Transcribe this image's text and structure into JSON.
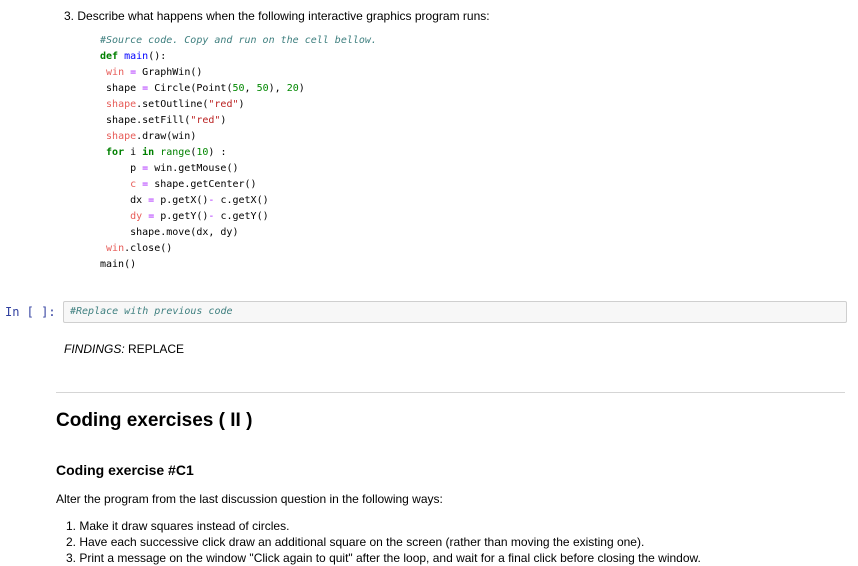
{
  "colors": {
    "comment": "#408080",
    "keyword": "#008000",
    "builtin": "#008000",
    "defname": "#0000ff",
    "operator": "#aa22ff",
    "number": "#008800",
    "string": "#ba2121",
    "error": "#e75c58",
    "plain": "#000000",
    "prompt": "#303f9f",
    "cell-bg": "#f7f7f7",
    "cell-border": "#cfcfcf",
    "divider": "#d5d5d5"
  },
  "question": {
    "marker": "3.",
    "text": "Describe what happens when the following interactive graphics program runs:"
  },
  "code_block": {
    "language": "python",
    "lines": [
      [
        [
          "c",
          "#Source code. Copy and run on the cell bellow."
        ]
      ],
      [
        [
          "k",
          "def"
        ],
        [
          "t",
          " "
        ],
        [
          "d",
          "main"
        ],
        [
          "t",
          "():"
        ]
      ],
      [
        [
          "t",
          " "
        ],
        [
          "e",
          "win"
        ],
        [
          "t",
          " "
        ],
        [
          "o",
          "="
        ],
        [
          "t",
          " GraphWin()"
        ]
      ],
      [
        [
          "t",
          " shape "
        ],
        [
          "o",
          "="
        ],
        [
          "t",
          " Circle(Point("
        ],
        [
          "n",
          "50"
        ],
        [
          "t",
          ", "
        ],
        [
          "n",
          "50"
        ],
        [
          "t",
          "), "
        ],
        [
          "n",
          "20"
        ],
        [
          "t",
          ")"
        ]
      ],
      [
        [
          "t",
          " "
        ],
        [
          "e",
          "shape"
        ],
        [
          "t",
          ".setOutline("
        ],
        [
          "s",
          "\"red\""
        ],
        [
          "t",
          ")"
        ]
      ],
      [
        [
          "t",
          " shape.setFill("
        ],
        [
          "s",
          "\"red\""
        ],
        [
          "t",
          ")"
        ]
      ],
      [
        [
          "t",
          " "
        ],
        [
          "e",
          "shape"
        ],
        [
          "t",
          ".draw(win)"
        ]
      ],
      [
        [
          "t",
          " "
        ],
        [
          "k",
          "for"
        ],
        [
          "t",
          " i "
        ],
        [
          "k",
          "in"
        ],
        [
          "t",
          " "
        ],
        [
          "b",
          "range"
        ],
        [
          "t",
          "("
        ],
        [
          "n",
          "10"
        ],
        [
          "t",
          ") :"
        ]
      ],
      [
        [
          "t",
          "     p "
        ],
        [
          "o",
          "="
        ],
        [
          "t",
          " win.getMouse()"
        ]
      ],
      [
        [
          "t",
          "     "
        ],
        [
          "e",
          "c"
        ],
        [
          "t",
          " "
        ],
        [
          "o",
          "="
        ],
        [
          "t",
          " shape.getCenter()"
        ]
      ],
      [
        [
          "t",
          "     dx "
        ],
        [
          "o",
          "="
        ],
        [
          "t",
          " p.getX()"
        ],
        [
          "o",
          "-"
        ],
        [
          "t",
          " c.getX()"
        ]
      ],
      [
        [
          "t",
          "     "
        ],
        [
          "e",
          "dy"
        ],
        [
          "t",
          " "
        ],
        [
          "o",
          "="
        ],
        [
          "t",
          " p.getY()"
        ],
        [
          "o",
          "-"
        ],
        [
          "t",
          " c.getY()"
        ]
      ],
      [
        [
          "t",
          "     shape.move(dx, dy)"
        ]
      ],
      [
        [
          "t",
          " "
        ],
        [
          "e",
          "win"
        ],
        [
          "t",
          ".close()"
        ]
      ],
      [
        [
          "t",
          "main()"
        ]
      ]
    ]
  },
  "input_cell": {
    "prompt": "In [ ]:",
    "code": "#Replace with previous code"
  },
  "findings": {
    "label": "FINDINGS:",
    "value": "REPLACE"
  },
  "section": {
    "title": "Coding exercises ( II )",
    "subtitle": "Coding exercise #C1",
    "intro": "Alter the program from the last discussion question in the following ways:"
  },
  "exercises": {
    "items": [
      {
        "marker": "1.",
        "text": "Make it draw squares instead of circles."
      },
      {
        "marker": "2.",
        "text": "Have each successive click draw an additional square on the screen (rather than moving the existing one)."
      },
      {
        "marker": "3.",
        "text": "Print a message on the window \"Click again to quit\" after the loop, and wait for a final click before closing the window."
      }
    ]
  }
}
